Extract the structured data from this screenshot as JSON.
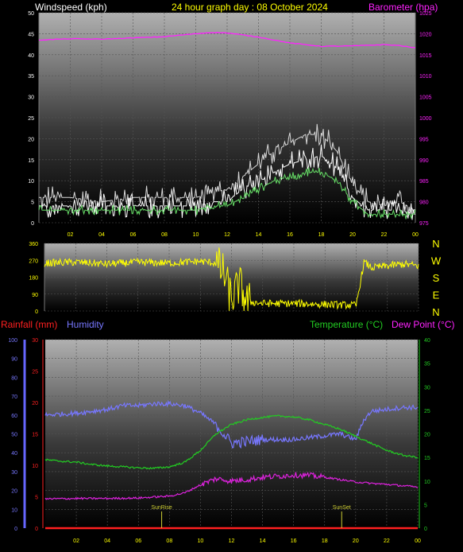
{
  "page": {
    "title": "24 hour graph day : 08 October 2024"
  },
  "colors": {
    "windspeed": "#ffffff",
    "gust": "#d8d8d8",
    "avg_wind": "#66dd66",
    "barometer": "#ff22ff",
    "direction": "#ffff00",
    "rainfall": "#ff2020",
    "humidity": "#7777ff",
    "temperature": "#22cc22",
    "dewpoint": "#dd22dd",
    "sun": "#cccc33",
    "bg_top": "#b8b8b8",
    "bg_bottom": "#000000"
  },
  "chart_data": [
    {
      "id": "wind-baro",
      "type": "line",
      "left_label": "Windspeed (kph)",
      "right_label": "Barometer (hpa)",
      "x_ticks": [
        "02",
        "04",
        "06",
        "08",
        "10",
        "12",
        "14",
        "16",
        "18",
        "20",
        "22",
        "00"
      ],
      "y_left": {
        "min": 0,
        "max": 50,
        "ticks": [
          0,
          5,
          10,
          15,
          20,
          25,
          30,
          35,
          40,
          45,
          50
        ]
      },
      "y_right": {
        "min": 975,
        "max": 1025,
        "ticks": [
          975,
          980,
          985,
          990,
          995,
          1000,
          1005,
          1010,
          1015,
          1020,
          1025
        ]
      },
      "series": [
        {
          "key": "gust",
          "hours": [
            0,
            2,
            4,
            6,
            8,
            10,
            11,
            12,
            13,
            14,
            15,
            16,
            17,
            18,
            19,
            20,
            21,
            22,
            23,
            24
          ],
          "values": [
            6,
            6,
            5,
            6,
            6,
            6,
            7,
            8,
            11,
            14,
            17,
            19,
            21,
            21,
            17,
            9,
            5,
            4,
            5,
            3
          ]
        },
        {
          "key": "windspeed",
          "hours": [
            0,
            2,
            4,
            6,
            8,
            10,
            11,
            12,
            13,
            14,
            15,
            16,
            17,
            18,
            19,
            20,
            21,
            22,
            23,
            24
          ],
          "values": [
            4,
            4,
            4,
            4,
            4,
            4,
            5,
            5,
            8,
            10,
            12,
            14,
            15,
            16,
            13,
            6,
            3,
            3,
            3,
            2
          ]
        },
        {
          "key": "avg_wind",
          "hours": [
            0,
            2,
            4,
            6,
            8,
            10,
            11,
            12,
            13,
            14,
            15,
            16,
            17,
            18,
            19,
            20,
            21,
            22,
            23,
            24
          ],
          "values": [
            3,
            3,
            3,
            3,
            3,
            3,
            4,
            4,
            6,
            8,
            10,
            11,
            12,
            12,
            10,
            5,
            2,
            2,
            2,
            2
          ]
        },
        {
          "key": "barometer",
          "axis": "right",
          "hours": [
            0,
            2,
            4,
            6,
            8,
            10,
            11,
            12,
            14,
            16,
            18,
            20,
            22,
            23,
            24
          ],
          "values": [
            1018.5,
            1018.8,
            1018.7,
            1019.0,
            1019.3,
            1020.0,
            1020.3,
            1020.2,
            1019.2,
            1017.8,
            1017.0,
            1017.1,
            1017.4,
            1017.2,
            1016.6
          ]
        }
      ]
    },
    {
      "id": "direction",
      "type": "line",
      "y": {
        "min": 0,
        "max": 360,
        "ticks": [
          0,
          90,
          180,
          270,
          360
        ]
      },
      "compass": [
        "N",
        "W",
        "S",
        "E",
        "N"
      ],
      "series": [
        {
          "key": "direction",
          "hours": [
            0,
            2,
            4,
            6,
            8,
            10,
            11,
            11.5,
            12,
            12.5,
            13,
            14,
            16,
            18,
            20,
            20.5,
            21,
            22,
            23,
            24
          ],
          "values": [
            255,
            260,
            250,
            260,
            255,
            265,
            255,
            200,
            60,
            140,
            50,
            40,
            40,
            35,
            30,
            260,
            230,
            240,
            250,
            240
          ]
        }
      ]
    },
    {
      "id": "rain-hum-temp",
      "type": "line",
      "labels": {
        "rainfall": "Rainfall (mm)",
        "humidity": "Humidity",
        "temperature": "Temperature (°C)",
        "dewpoint": "Dew Point (°C)"
      },
      "x_ticks": [
        "02",
        "04",
        "06",
        "08",
        "10",
        "12",
        "14",
        "16",
        "18",
        "20",
        "22",
        "00"
      ],
      "y_humidity": {
        "min": 0,
        "max": 100,
        "ticks": [
          0,
          10,
          20,
          30,
          40,
          50,
          60,
          70,
          80,
          90,
          100
        ]
      },
      "y_rain": {
        "min": 0,
        "max": 30,
        "ticks": [
          0,
          5,
          10,
          15,
          20,
          25,
          30
        ]
      },
      "y_temp": {
        "min": 0,
        "max": 40,
        "ticks": [
          0,
          5,
          10,
          15,
          20,
          25,
          30,
          35,
          40
        ]
      },
      "series": [
        {
          "key": "humidity",
          "axis": "humidity",
          "hours": [
            0,
            2,
            4,
            5,
            6,
            7,
            8,
            9,
            10,
            11,
            12,
            13,
            14,
            16,
            18,
            19,
            20,
            20.5,
            21,
            22,
            23,
            24
          ],
          "values": [
            60,
            61,
            63,
            65,
            65,
            66,
            66,
            65,
            61,
            55,
            45,
            46,
            47,
            47,
            49,
            50,
            47,
            57,
            62,
            63,
            64,
            64
          ]
        },
        {
          "key": "temperature",
          "axis": "temp",
          "hours": [
            0,
            1,
            2,
            3,
            4,
            5,
            6,
            7,
            8,
            9,
            10,
            11,
            12,
            13,
            14,
            15,
            16,
            17,
            18,
            19,
            20,
            21,
            22,
            23,
            24
          ],
          "values": [
            14.5,
            14.2,
            14.0,
            13.5,
            13.2,
            13.0,
            12.8,
            12.7,
            13.0,
            14.0,
            16.5,
            20.0,
            22.0,
            23.0,
            23.5,
            23.8,
            23.6,
            23.0,
            22.0,
            21.0,
            19.5,
            18.0,
            16.5,
            15.5,
            15.0
          ]
        },
        {
          "key": "dewpoint",
          "axis": "temp",
          "hours": [
            0,
            2,
            4,
            6,
            8,
            9,
            10,
            11,
            12,
            13,
            14,
            15,
            16,
            17,
            18,
            19,
            20,
            21,
            22,
            23,
            24
          ],
          "values": [
            6.2,
            6.3,
            6.3,
            6.4,
            6.8,
            7.5,
            9.2,
            10.5,
            10.0,
            10.3,
            10.8,
            11.0,
            11.3,
            11.2,
            10.8,
            10.3,
            9.8,
            9.5,
            9.3,
            9.0,
            8.7
          ]
        },
        {
          "key": "rainfall",
          "axis": "rain",
          "hours": [
            0,
            24
          ],
          "values": [
            0,
            0
          ]
        }
      ],
      "events": [
        {
          "label": "SunRise",
          "hour": 7.5
        },
        {
          "label": "SunSet",
          "hour": 19.1
        }
      ]
    }
  ]
}
